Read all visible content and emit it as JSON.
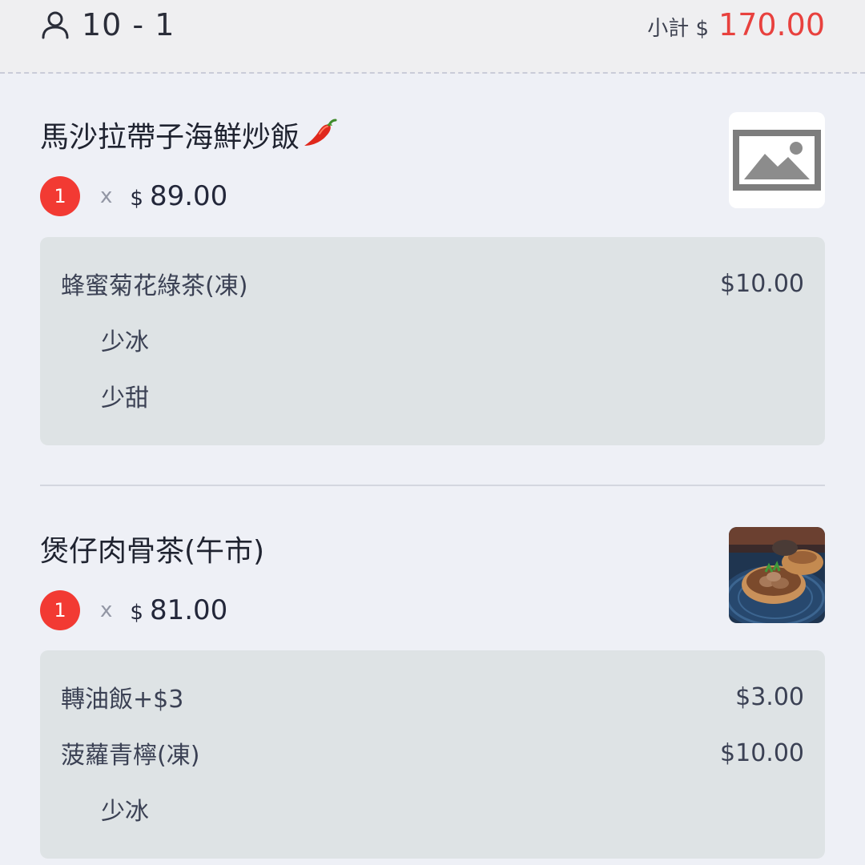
{
  "header": {
    "table_label": "10 - 1",
    "subtotal_label": "小計 $",
    "subtotal_value": "170.00",
    "icon": "person-icon"
  },
  "colors": {
    "accent_red": "#e8413e",
    "badge_red": "#f23a33",
    "background": "#eef0f6",
    "options_background": "#dee3e5"
  },
  "items": [
    {
      "name": "馬沙拉帶子海鮮炒飯",
      "spicy_icon": "chili-pepper-icon",
      "quantity": "1",
      "times": "x",
      "currency": "$",
      "price": "89.00",
      "image": "image-placeholder-icon",
      "options": [
        {
          "label": "蜂蜜菊花綠茶(凍)",
          "price": "$10.00"
        },
        {
          "label": "少冰",
          "price": ""
        },
        {
          "label": "少甜",
          "price": ""
        }
      ]
    },
    {
      "name": "煲仔肉骨茶(午市)",
      "quantity": "1",
      "times": "x",
      "currency": "$",
      "price": "81.00",
      "image": "bak-kut-teh-photo",
      "options": [
        {
          "label": "轉油飯+$3",
          "price": "$3.00"
        },
        {
          "label": "菠蘿青檸(凍)",
          "price": "$10.00"
        },
        {
          "label": "少冰",
          "price": ""
        }
      ]
    }
  ]
}
